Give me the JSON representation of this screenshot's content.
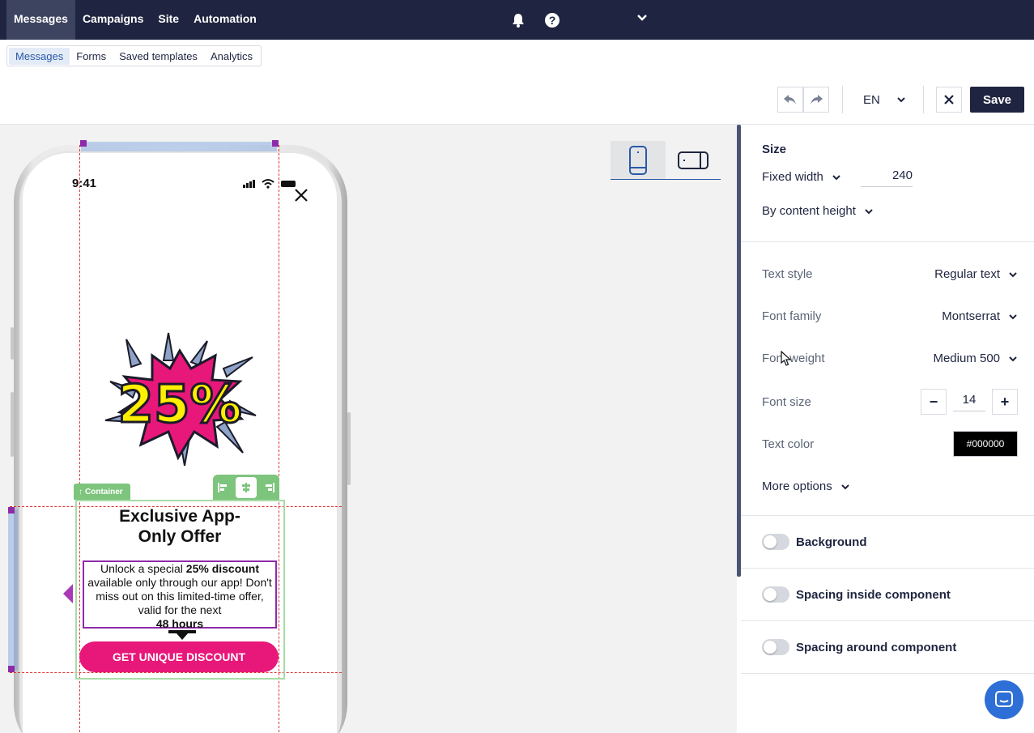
{
  "topnav": {
    "items": [
      "Messages",
      "Campaigns",
      "Site",
      "Automation"
    ]
  },
  "subnav": {
    "items": [
      "Messages",
      "Forms",
      "Saved templates",
      "Analytics"
    ]
  },
  "toolbar": {
    "language": "EN",
    "save_label": "Save"
  },
  "phone": {
    "time": "9:41",
    "container_label": "Container",
    "burst_text": "25%",
    "headline_line1": "Exclusive App-",
    "headline_line2": "Only Offer",
    "body_part1": "Unlock a special ",
    "body_bold1": "25% discount",
    "body_part2": " available only through our app! Don't miss out on this limited-time offer, valid for the next ",
    "body_bold2": "48 hours",
    "cta_label": "GET UNIQUE DISCOUNT"
  },
  "panel": {
    "size_title": "Size",
    "width_mode": "Fixed width",
    "width_value": "240",
    "height_mode": "By content height",
    "text_style_label": "Text style",
    "text_style_value": "Regular text",
    "font_family_label": "Font family",
    "font_family_value": "Montserrat",
    "font_weight_label": "Font weight",
    "font_weight_value": "Medium 500",
    "font_size_label": "Font size",
    "font_size_value": "14",
    "text_color_label": "Text color",
    "text_color_value": "#000000",
    "more_options": "More options",
    "background_label": "Background",
    "spacing_inside_label": "Spacing inside component",
    "spacing_around_label": "Spacing around component"
  },
  "colors": {
    "navbar": "#1f2540",
    "accent": "#2a59a8",
    "cta": "#e8177a",
    "selection": "#8e2aa8",
    "container": "#7dc47d"
  }
}
